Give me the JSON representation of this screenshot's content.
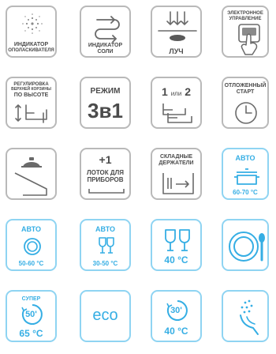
{
  "tiles": {
    "rinse_indicator": {
      "line1": "ИНДИКАТОР",
      "line2": "ОПОЛАСКИВАТЕЛЯ"
    },
    "salt_indicator": {
      "line1": "ИНДИКАТОР",
      "line2": "СОЛИ"
    },
    "beam": {
      "label": "ЛУЧ"
    },
    "electronic_control": {
      "line1": "ЭЛЕКТРОННОЕ",
      "line2": "УПРАВЛЕНИЕ"
    },
    "basket_height": {
      "line1": "РЕГУЛИРОВКА",
      "line2": "ВЕРХНЕЙ КОРЗИНЫ",
      "line3": "ПО ВЫСОТЕ"
    },
    "mode_3in1": {
      "label": "РЕЖИМ",
      "big": "3в1"
    },
    "one_or_two": {
      "one": "1",
      "or": "или",
      "two": "2"
    },
    "delayed_start": {
      "line1": "ОТЛОЖЕННЫЙ",
      "line2": "СТАРТ"
    },
    "extra_tray": {
      "plus": "+1",
      "line1": "ЛОТОК ДЛЯ",
      "line2": "ПРИБОРОВ"
    },
    "folding_holders": {
      "line1": "СКЛАДНЫЕ",
      "line2": "ДЕРЖАТЕЛИ"
    },
    "auto_60_70": {
      "label": "АВТО",
      "temp": "60-70 °C"
    },
    "auto_50_60": {
      "label": "АВТО",
      "temp": "50-60 °C"
    },
    "auto_30_50": {
      "label": "АВТО",
      "temp": "30-50 °C"
    },
    "glass_40": {
      "temp": "40 °C"
    },
    "super_65": {
      "label": "СУПЕР",
      "minutes": "50'",
      "temp": "65 °C"
    },
    "eco": {
      "label": "eco"
    },
    "quick_30": {
      "minutes": "30'",
      "temp": "40 °C"
    }
  },
  "colors": {
    "gray": "#b9b9b9",
    "dark": "#4b4b4b",
    "blue": "#35aee4",
    "blue_border": "#8fd4f2"
  }
}
